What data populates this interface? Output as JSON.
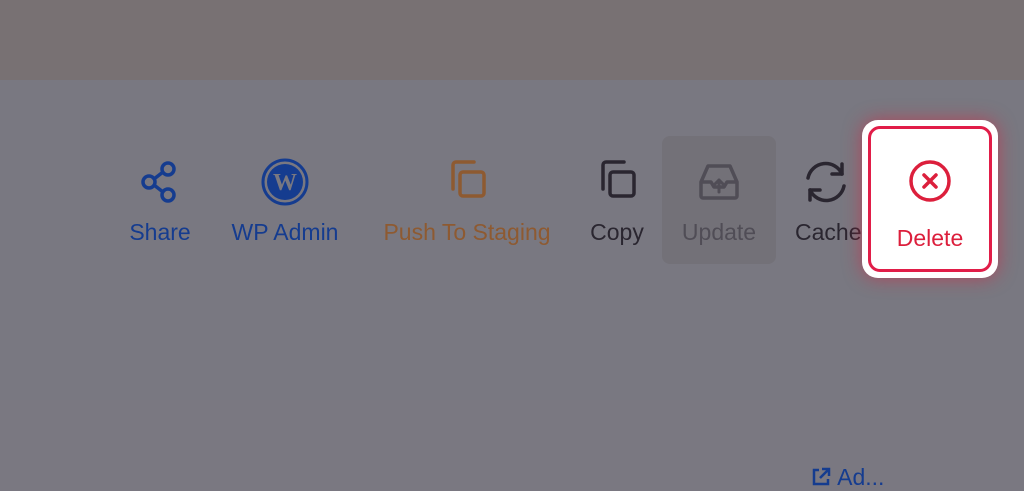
{
  "actions": {
    "share": {
      "label": "Share",
      "icon": "share-icon",
      "color": "#153c8f"
    },
    "wp_admin": {
      "label": "WP Admin",
      "icon": "wordpress-icon",
      "color": "#153c8f"
    },
    "push_to_staging": {
      "label": "Push To Staging",
      "icon": "push-copy-icon",
      "color": "#8e5a31"
    },
    "copy": {
      "label": "Copy",
      "icon": "copy-icon",
      "color": "#2a2630"
    },
    "update": {
      "label": "Update",
      "icon": "inbox-upload-icon",
      "color": "#504d56"
    },
    "cache": {
      "label": "Cache",
      "icon": "refresh-icon",
      "color": "#2a2630"
    },
    "delete": {
      "label": "Delete",
      "icon": "close-circle-icon",
      "color": "#dc1f3c"
    }
  },
  "bottom_link": {
    "label": "Ad..."
  },
  "colors": {
    "overlay_top": "#787173",
    "overlay": "#797881",
    "delete_border": "#e11d48"
  }
}
